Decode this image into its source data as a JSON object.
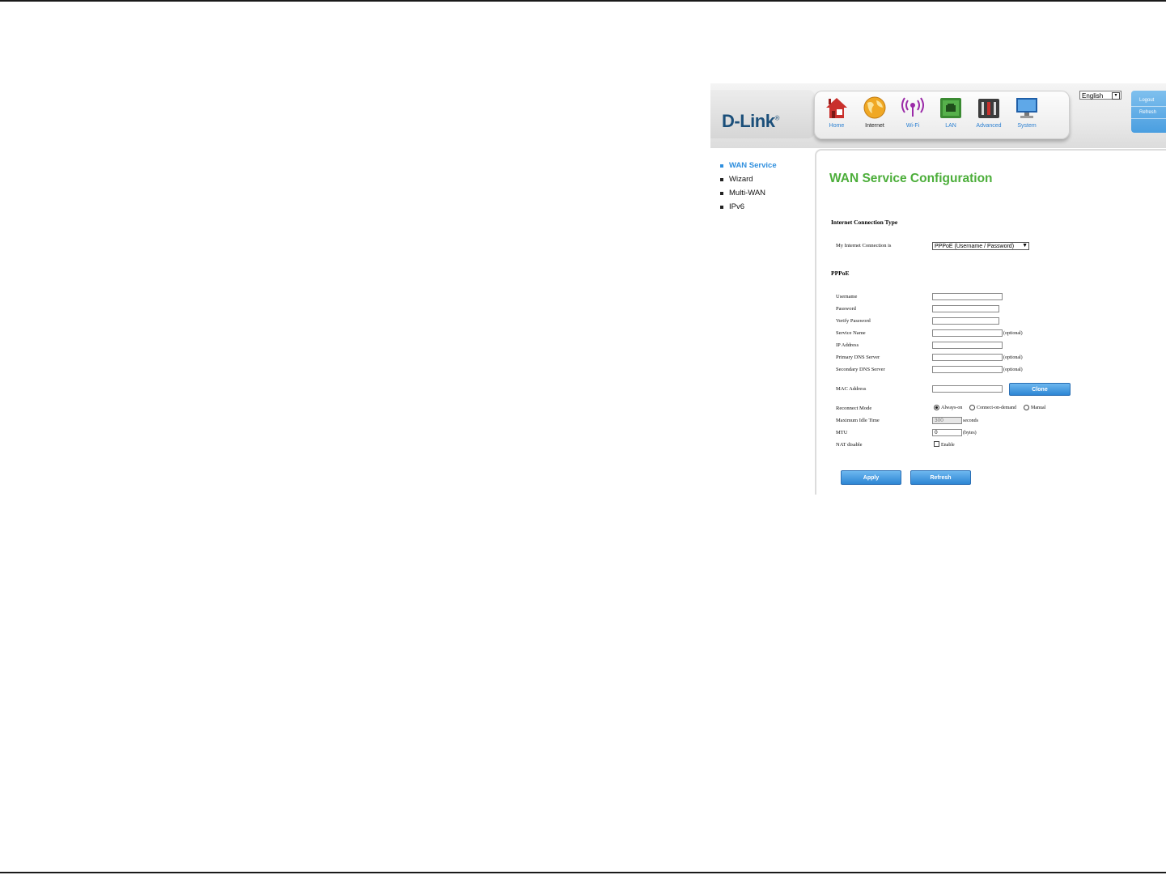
{
  "header": {
    "logo": "D-Link",
    "logo_mark": "®",
    "nav": [
      {
        "label": "Home",
        "icon": "house-icon"
      },
      {
        "label": "Internet",
        "icon": "globe-icon"
      },
      {
        "label": "Wi-Fi",
        "icon": "wifi-antenna-icon"
      },
      {
        "label": "LAN",
        "icon": "network-port-icon"
      },
      {
        "label": "Advanced",
        "icon": "toolbox-icon"
      },
      {
        "label": "System",
        "icon": "monitor-icon"
      }
    ],
    "active_nav": "Internet",
    "language": "English",
    "side_links": [
      "Logout",
      "Refresh"
    ]
  },
  "menu": {
    "items": [
      "WAN Service",
      "Wizard",
      "Multi-WAN",
      "IPv6"
    ],
    "active": "WAN Service"
  },
  "page": {
    "title": "WAN Service Configuration",
    "section_connection": "Internet Connection Type",
    "connection_label": "My Internet Connection is",
    "connection_value": "PPPoE (Username / Password)",
    "section_pppoe": "PPPoE",
    "fields": {
      "username": {
        "label": "Username",
        "value": ""
      },
      "password": {
        "label": "Password",
        "value": ""
      },
      "verify_password": {
        "label": "Verify Password",
        "value": ""
      },
      "service_name": {
        "label": "Service Name",
        "value": "",
        "note": "(optional)"
      },
      "ip_address": {
        "label": "IP Address",
        "value": ""
      },
      "primary_dns": {
        "label": "Primary DNS Server",
        "value": "",
        "note": "(optional)"
      },
      "secondary_dns": {
        "label": "Secondary DNS Server",
        "value": "",
        "note": "(optional)"
      },
      "mac_address": {
        "label": "MAC Address",
        "value": ""
      },
      "reconnect_mode": {
        "label": "Reconnect Mode",
        "options": [
          "Always-on",
          "Connect-on-demand",
          "Manual"
        ],
        "selected": "Always-on"
      },
      "max_idle": {
        "label": "Maximum Idle Time",
        "value": "300",
        "note": "seconds"
      },
      "mtu": {
        "label": "MTU",
        "value": "0",
        "note": "(bytes)"
      },
      "nat_disable": {
        "label": "NAT disable",
        "option": "Enable",
        "checked": false
      }
    },
    "buttons": {
      "clone": "Clone",
      "apply": "Apply",
      "refresh": "Refresh"
    }
  },
  "colors": {
    "title_green": "#4cae3a",
    "link_blue": "#2f8fde",
    "button_blue": "#3a8fd8"
  }
}
